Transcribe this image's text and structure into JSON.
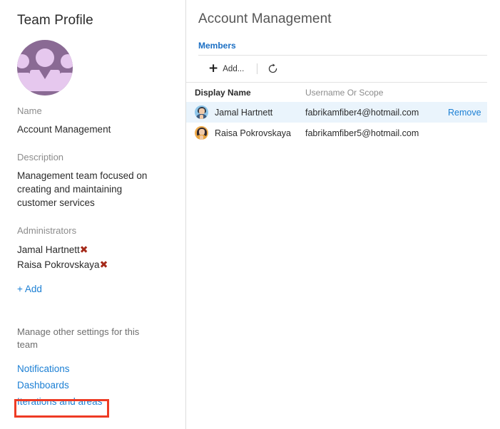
{
  "left": {
    "title": "Team Profile",
    "avatar_icon": "team-group-avatar-icon",
    "name_label": "Name",
    "name_value": "Account Management",
    "description_label": "Description",
    "description_value": "Management team focused on creating and maintaining customer services",
    "administrators_label": "Administrators",
    "administrators": [
      {
        "name": "Jamal Hartnett",
        "remove_icon": "remove-x-icon"
      },
      {
        "name": "Raisa Pokrovskaya",
        "remove_icon": "remove-x-icon"
      }
    ],
    "add_admin_label": "+ Add",
    "manage_text": "Manage other settings for this team",
    "settings_links": [
      {
        "label": "Notifications",
        "highlighted": false
      },
      {
        "label": "Dashboards",
        "highlighted": false
      },
      {
        "label": "Iterations and areas",
        "highlighted": true
      }
    ]
  },
  "right": {
    "page_title": "Account Management",
    "tabs": [
      {
        "label": "Members",
        "selected": true
      }
    ],
    "toolbar": {
      "add_label": "Add...",
      "add_icon": "plus-icon",
      "refresh_icon": "refresh-icon"
    },
    "table": {
      "columns": [
        "Display Name",
        "Username Or Scope",
        ""
      ],
      "rows": [
        {
          "avatar_icon": "person-avatar-blue-icon",
          "display_name": "Jamal Hartnett",
          "username": "fabrikamfiber4@hotmail.com",
          "action": "Remove",
          "selected": true
        },
        {
          "avatar_icon": "person-avatar-orange-icon",
          "display_name": "Raisa Pokrovskaya",
          "username": "fabrikamfiber5@hotmail.com",
          "action": "",
          "selected": false
        }
      ]
    }
  },
  "colors": {
    "link_blue": "#1b7fd4",
    "tab_blue": "#1b6fc4",
    "highlight_red": "#ee3b24",
    "remove_x_red": "#a52a1a",
    "avatar_purple_bg": "#8a6a94",
    "avatar_purple_fg": "#e6c8ee",
    "row_selected_bg": "#eaf4fc"
  }
}
